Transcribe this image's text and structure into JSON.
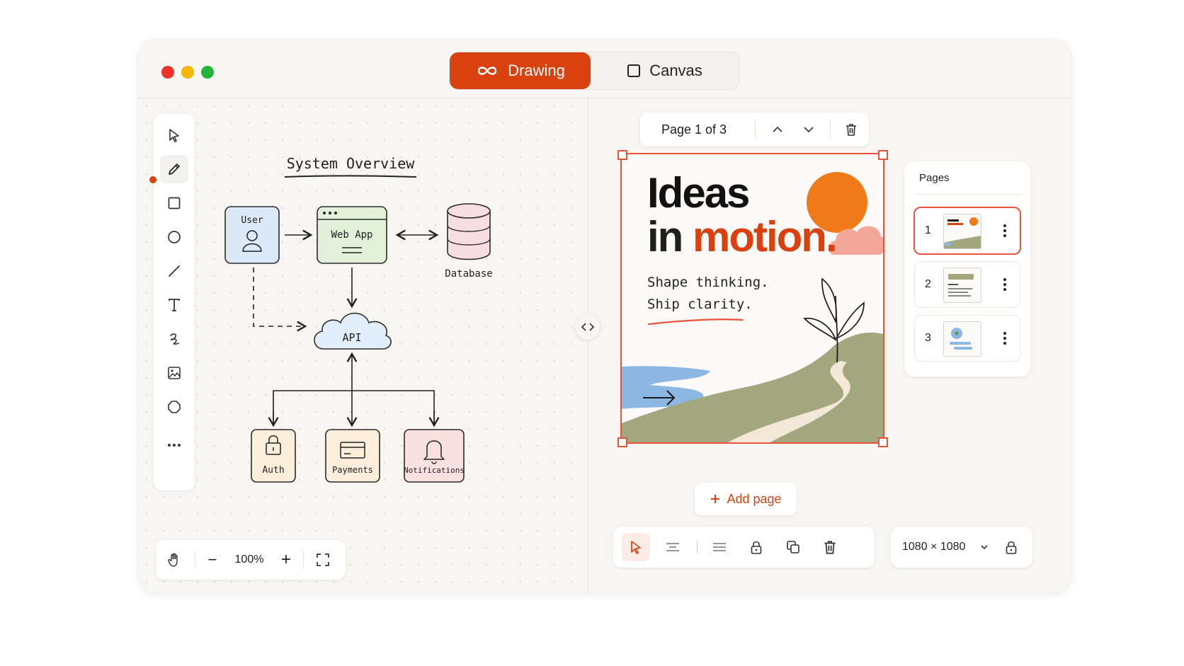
{
  "window": {
    "mode_tabs": [
      {
        "label": "Drawing",
        "icon": "infinity-icon",
        "active": true
      },
      {
        "label": "Canvas",
        "icon": "square-icon",
        "active": false
      }
    ]
  },
  "left_toolbar": {
    "tools": [
      "pointer-icon",
      "pen-icon",
      "rectangle-icon",
      "circle-icon",
      "line-icon",
      "text-icon",
      "scribble-icon",
      "image-icon",
      "shape-icon",
      "more-icon"
    ],
    "active_tool": "pen-icon"
  },
  "diagram": {
    "title": "System Overview",
    "nodes": {
      "user": "User",
      "web_app": "Web App",
      "database": "Database",
      "api": "API",
      "auth": "Auth",
      "payments": "Payments",
      "notifications": "Notifications"
    },
    "colors": {
      "user": "#dbe9f8",
      "web_app": "#e2efd9",
      "database": "#f8dde3",
      "api": "#e2eefb",
      "auth": "#fbeedb",
      "payments": "#fbeedb",
      "notifications": "#f9e1df"
    }
  },
  "zoom": {
    "level": "100%",
    "minus": "−",
    "plus": "+"
  },
  "page_nav": {
    "label": "Page 1 of 3"
  },
  "artboard": {
    "title_line1": "Ideas",
    "title_line2_prefix": "in ",
    "title_line2_accent": "motion.",
    "subtitle_line1": "Shape thinking.",
    "subtitle_line2": "Ship clarity.",
    "colors": {
      "accent": "#d9420f",
      "sun": "#f07a1a",
      "cloud": "#f2a79a",
      "hill": "#a3a77e",
      "water": "#8cb7e2"
    }
  },
  "pages_panel": {
    "title": "Pages",
    "pages": [
      {
        "number": "1",
        "selected": true
      },
      {
        "number": "2",
        "selected": false
      },
      {
        "number": "3",
        "selected": false
      }
    ]
  },
  "add_page": {
    "label": "Add page"
  },
  "bottom_toolbar": {
    "tools": [
      "select-icon",
      "align-center-icon",
      "align-left-icon",
      "lock-icon",
      "duplicate-icon",
      "trash-icon"
    ],
    "active_tool": "select-icon"
  },
  "size": {
    "value": "1080 × 1080"
  },
  "brand": {
    "accent": "#d9420f",
    "selection": "#e8533a"
  }
}
